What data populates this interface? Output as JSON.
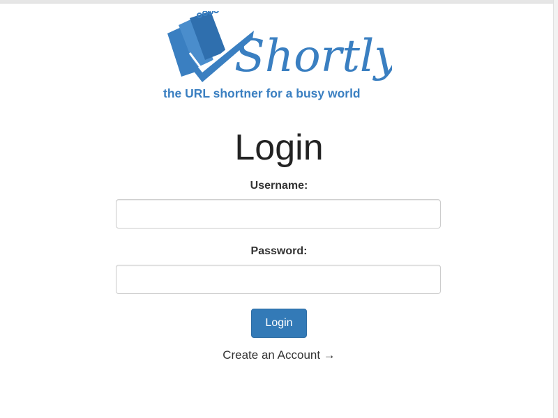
{
  "brand": {
    "name": "Shortly",
    "tagline": "the URL shortner for a busy world",
    "color": "#3a7fc1"
  },
  "login": {
    "title": "Login",
    "username_label": "Username:",
    "username_value": "",
    "password_label": "Password:",
    "password_value": "",
    "submit_label": "Login",
    "create_account_label": "Create an Account →"
  },
  "colors": {
    "button_bg": "#337ab7",
    "button_text": "#ffffff",
    "title_text": "#222222"
  }
}
